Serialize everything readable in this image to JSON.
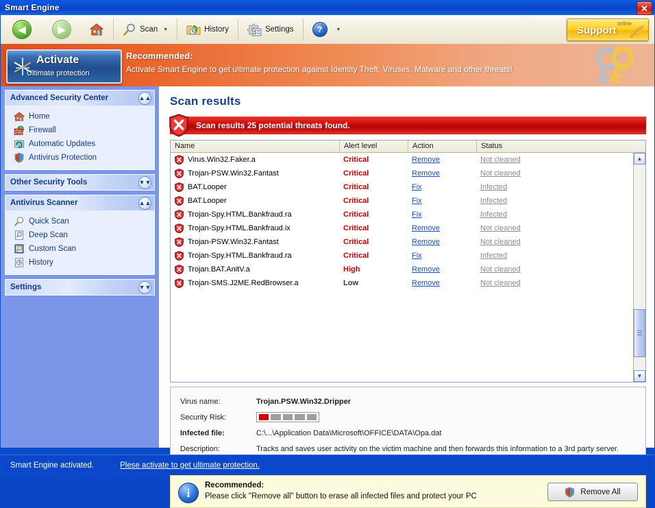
{
  "window": {
    "title": "Smart Engine",
    "close_label": "✕"
  },
  "toolbar": {
    "back": {
      "icon": "back-arrow-icon",
      "glyph": "◀"
    },
    "forward": {
      "icon": "forward-arrow-icon",
      "glyph": "▶"
    },
    "home": {
      "icon": "home-icon"
    },
    "scan": {
      "label": "Scan",
      "icon": "magnifier-icon",
      "caret": "▼"
    },
    "history": {
      "label": "History",
      "icon": "history-folder-icon"
    },
    "settings": {
      "label": "Settings",
      "icon": "gear-icon"
    },
    "help": {
      "label": "?",
      "icon": "help-icon",
      "caret": "▼"
    },
    "support": {
      "online_label": "online",
      "label": "Support"
    }
  },
  "banner": {
    "activate_title": "Activate",
    "activate_subtitle": "Ultimate protection",
    "headline": "Recommended:",
    "message": "Activate Smart Engine to get ultimate protection against Identity Theft, Viruses, Malware and other threats!"
  },
  "sidebar": {
    "panels": [
      {
        "title": "Advanced Security Center",
        "toggle": "collapse",
        "expanded": true,
        "items": [
          {
            "label": "Home",
            "icon": "home-icon"
          },
          {
            "label": "Firewall",
            "icon": "firewall-brick-icon"
          },
          {
            "label": "Automatic Updates",
            "icon": "updates-icon"
          },
          {
            "label": "Antivirus Protection",
            "icon": "shield-icon"
          }
        ]
      },
      {
        "title": "Other Security Tools",
        "toggle": "expand",
        "expanded": false,
        "items": []
      },
      {
        "title": "Antivirus Scanner",
        "toggle": "collapse",
        "expanded": true,
        "items": [
          {
            "label": "Quick Scan",
            "icon": "magnifier-icon"
          },
          {
            "label": "Deep Scan",
            "icon": "deep-scan-icon"
          },
          {
            "label": "Custom Scan",
            "icon": "custom-scan-icon"
          },
          {
            "label": "History",
            "icon": "clock-icon"
          }
        ]
      },
      {
        "title": "Settings",
        "toggle": "expand",
        "expanded": false,
        "items": []
      }
    ]
  },
  "main": {
    "page_title": "Scan results",
    "alert": {
      "text": "Scan results 25 potential threats found.",
      "icon": "error-shield-icon",
      "color": "#c40606"
    },
    "table": {
      "columns": [
        "Name",
        "Alert level",
        "Action",
        "Status"
      ],
      "rows": [
        {
          "name": "Virus.Win32.Faker.a",
          "alert": "Critical",
          "level": "critical",
          "action": "Remove",
          "status": "Not cleaned"
        },
        {
          "name": "Trojan-PSW.Win32.Fantast",
          "alert": "Critical",
          "level": "critical",
          "action": "Remove",
          "status": "Not cleaned"
        },
        {
          "name": "BAT.Looper",
          "alert": "Critical",
          "level": "critical",
          "action": "Fix",
          "status": "Infected"
        },
        {
          "name": "BAT.Looper",
          "alert": "Critical",
          "level": "critical",
          "action": "Fix",
          "status": "Infected"
        },
        {
          "name": "Trojan-Spy.HTML.Bankfraud.ra",
          "alert": "Critical",
          "level": "critical",
          "action": "Fix",
          "status": "Infected"
        },
        {
          "name": "Trojan-Spy.HTML.Bankfraud.ix",
          "alert": "Critical",
          "level": "critical",
          "action": "Remove",
          "status": "Not cleaned"
        },
        {
          "name": "Trojan-PSW.Win32.Fantast",
          "alert": "Critical",
          "level": "critical",
          "action": "Remove",
          "status": "Not cleaned"
        },
        {
          "name": "Trojan-Spy.HTML.Bankfraud.ra",
          "alert": "Critical",
          "level": "critical",
          "action": "Fix",
          "status": "Infected"
        },
        {
          "name": "Trojan.BAT.AnitV.a",
          "alert": "High",
          "level": "high",
          "action": "Remove",
          "status": "Not cleaned"
        },
        {
          "name": "Trojan-SMS.J2ME.RedBrowser.a",
          "alert": "Low",
          "level": "low",
          "action": "Remove",
          "status": "Not cleaned"
        }
      ]
    },
    "detail": {
      "virus_name_label": "Virus name:",
      "virus_name_value": "Trojan.PSW.Win32.Dripper",
      "security_risk_label": "Security Risk:",
      "security_risk_filled": 1,
      "security_risk_total": 5,
      "infected_file_label": "Infected file:",
      "infected_file_value": "C:\\...\\Application Data\\Microsoft\\OFFICE\\DATA\\Opa.dat",
      "description_label": "Description:",
      "description_value": "Tracks and saves user activity on the victim machine and then forwards this information to a 3rd party server."
    },
    "recommendation": {
      "headline": "Recommended:",
      "message": "Please click \"Remove all\" button to erase all infected files and protect your PC",
      "button_label": "Remove All",
      "info_glyph": "i"
    }
  },
  "statusbar": {
    "text": "Smart Engine activated.",
    "link": "Plese activate to get ultimate protection."
  }
}
